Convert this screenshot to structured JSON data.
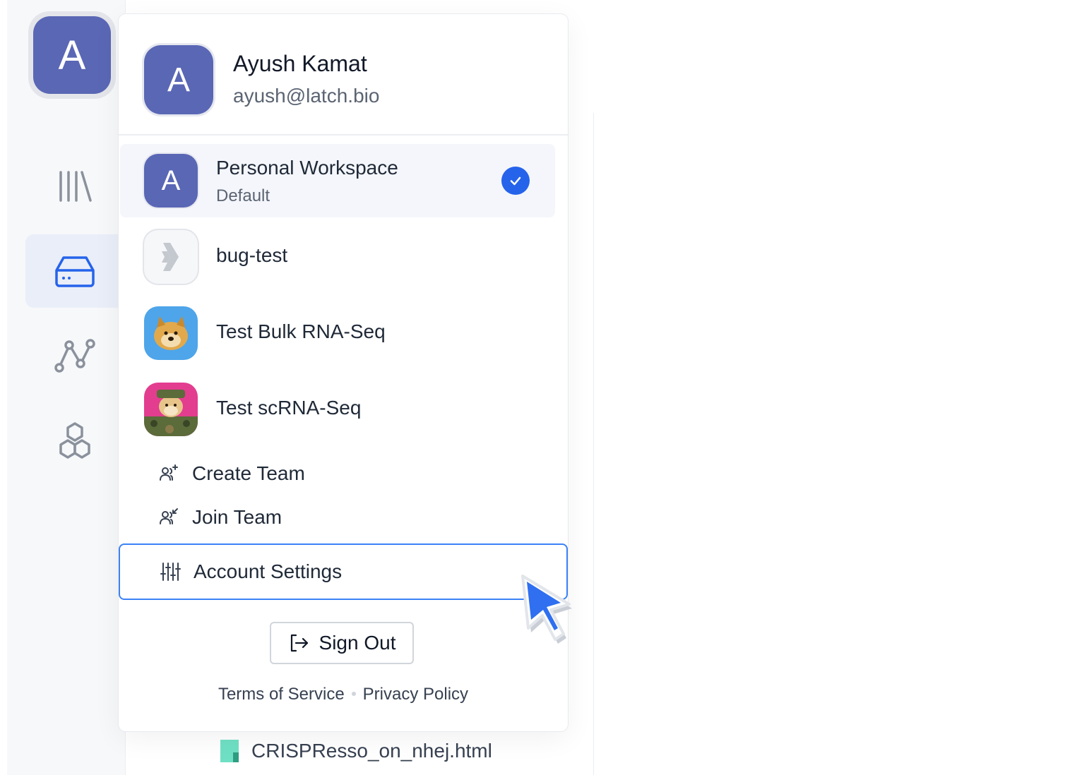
{
  "rail": {
    "avatar_letter": "A",
    "items": [
      {
        "name": "library",
        "icon": "library-icon"
      },
      {
        "name": "data",
        "icon": "drive-icon",
        "active": true
      },
      {
        "name": "workflows",
        "icon": "graph-icon"
      },
      {
        "name": "registry",
        "icon": "hexagons-icon"
      }
    ]
  },
  "profile": {
    "avatar_letter": "A",
    "name": "Ayush Kamat",
    "email": "ayush@latch.bio"
  },
  "workspaces": [
    {
      "name": "Personal Workspace",
      "subtitle": "Default",
      "avatar_letter": "A",
      "selected": true
    },
    {
      "name": "bug-test",
      "avatar": "latch-logo-icon"
    },
    {
      "name": "Test Bulk RNA-Seq",
      "avatar": "dog-avatar-blue"
    },
    {
      "name": "Test scRNA-Seq",
      "avatar": "dog-avatar-pink"
    }
  ],
  "actions": {
    "create_team": "Create Team",
    "join_team": "Join Team",
    "account_settings": "Account Settings",
    "sign_out": "Sign Out"
  },
  "footer": {
    "terms": "Terms of Service",
    "privacy": "Privacy Policy"
  },
  "background_file": {
    "name": "CRISPResso_on_nhej.html"
  },
  "colors": {
    "accent": "#2563eb",
    "avatar": "#5a67b5",
    "focus_border": "#3b82f6"
  }
}
